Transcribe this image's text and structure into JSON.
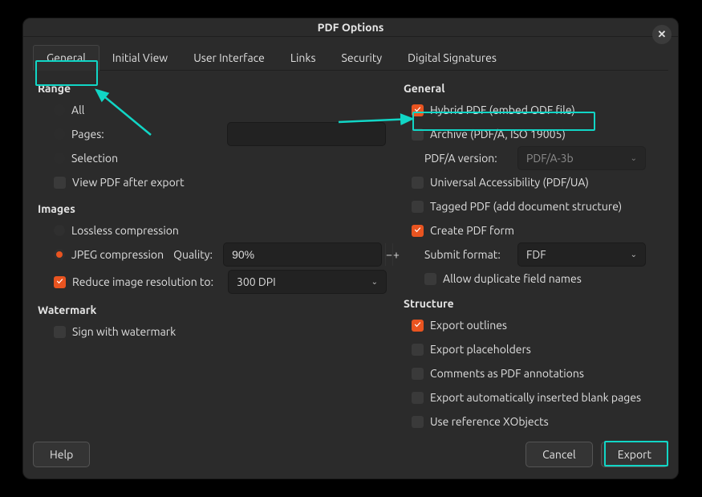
{
  "window": {
    "title": "PDF Options"
  },
  "tabs": [
    {
      "label": "General"
    },
    {
      "label": "Initial View"
    },
    {
      "label": "User Interface"
    },
    {
      "label": "Links"
    },
    {
      "label": "Security"
    },
    {
      "label": "Digital Signatures"
    }
  ],
  "left": {
    "range_head": "Range",
    "all": "All",
    "pages": "Pages:",
    "selection": "Selection",
    "view_after": "View PDF after export",
    "images_head": "Images",
    "lossless": "Lossless compression",
    "jpeg": "JPEG compression",
    "quality_label": "Quality:",
    "quality_value": "90%",
    "reduce": "Reduce image resolution to:",
    "dpi_value": "300 DPI",
    "watermark_head": "Watermark",
    "sign_with": "Sign with watermark"
  },
  "right": {
    "general_head": "General",
    "hybrid": "Hybrid PDF (embed ODF file)",
    "archive": "Archive (PDF/A, ISO 19005)",
    "pdfa_label": "PDF/A version:",
    "pdfa_value": "PDF/A-3b",
    "univ": "Universal Accessibility (PDF/UA)",
    "tagged": "Tagged PDF (add document structure)",
    "form": "Create PDF form",
    "submit_label": "Submit format:",
    "submit_value": "FDF",
    "dup": "Allow duplicate field names",
    "structure_head": "Structure",
    "outlines": "Export outlines",
    "placeholders": "Export placeholders",
    "comments": "Comments as PDF annotations",
    "blank": "Export automatically inserted blank pages",
    "xobj": "Use reference XObjects"
  },
  "buttons": {
    "help": "Help",
    "cancel": "Cancel",
    "export": "Export"
  }
}
